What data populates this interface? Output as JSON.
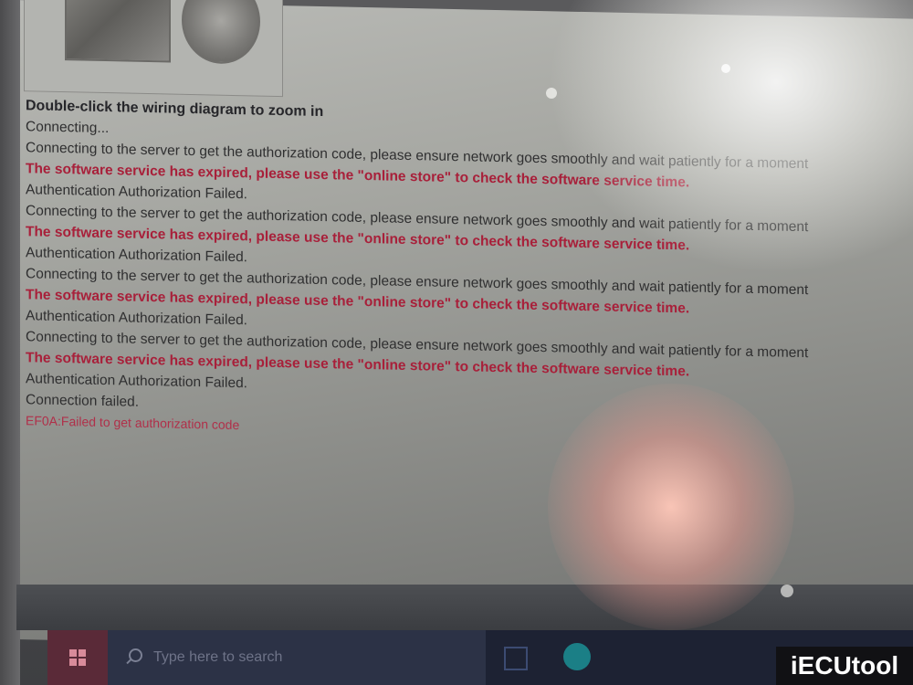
{
  "log": {
    "hint": "Double-click the wiring diagram to zoom in",
    "lines": [
      {
        "text": "Connecting...",
        "type": "normal"
      },
      {
        "text": "Connecting to the server to get the authorization code, please ensure network goes smoothly and wait patiently for a moment",
        "type": "normal"
      },
      {
        "text": "The software service has expired, please use the \"online store\" to check the software service time.",
        "type": "error"
      },
      {
        "text": "Authentication Authorization Failed.",
        "type": "normal"
      },
      {
        "text": "Connecting to the server to get the authorization code, please ensure network goes smoothly and wait patiently for a moment",
        "type": "normal"
      },
      {
        "text": "The software service has expired, please use the \"online store\" to check the software service time.",
        "type": "error"
      },
      {
        "text": "Authentication Authorization Failed.",
        "type": "normal"
      },
      {
        "text": "Connecting to the server to get the authorization code, please ensure network goes smoothly and wait patiently for a moment",
        "type": "normal"
      },
      {
        "text": "The software service has expired, please use the \"online store\" to check the software service time.",
        "type": "error"
      },
      {
        "text": "Authentication Authorization Failed.",
        "type": "normal"
      },
      {
        "text": "Connecting to the server to get the authorization code, please ensure network goes smoothly and wait patiently for a moment",
        "type": "normal"
      },
      {
        "text": "The software service has expired, please use the \"online store\" to check the software service time.",
        "type": "error"
      },
      {
        "text": "Authentication Authorization Failed.",
        "type": "normal"
      },
      {
        "text": "Connection failed.",
        "type": "normal"
      },
      {
        "text": "EF0A:Failed to get authorization code",
        "type": "errcode"
      }
    ]
  },
  "taskbar": {
    "search_placeholder": "Type here to search"
  },
  "watermark": {
    "brand": "iECUtool"
  },
  "icons": {
    "start": "windows-logo-icon",
    "search": "search-icon",
    "task_view": "task-view-icon",
    "browser": "edge-icon"
  }
}
